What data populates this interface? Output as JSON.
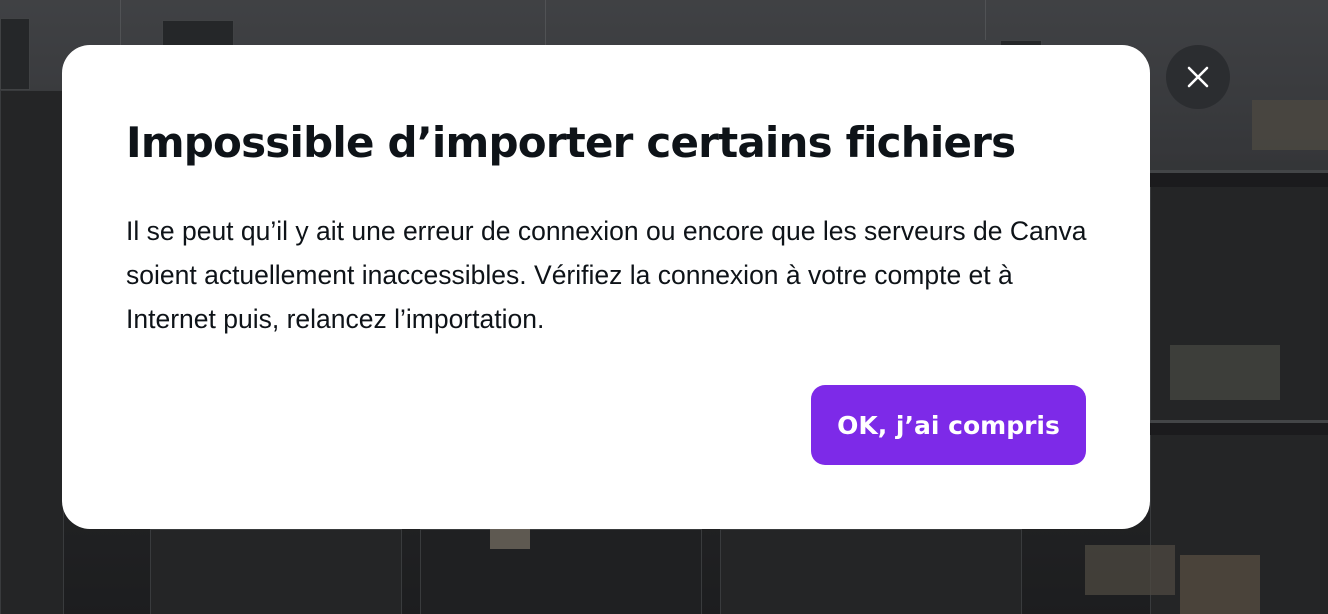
{
  "dialog": {
    "title": "Impossible d’importer certains fichiers",
    "message": "Il se peut qu’il y ait une erreur de connexion ou encore que les serveurs de Canva soient actuellement inaccessibles. Vérifiez la connexion à votre compte et à Internet puis, relancez l’importation.",
    "confirm_label": "OK, j’ai compris",
    "close_icon": "close-icon"
  },
  "colors": {
    "accent": "#7d2ae8",
    "dialog_background": "#ffffff",
    "text": "#0e1318",
    "close_button_background": "#2b2d30"
  }
}
